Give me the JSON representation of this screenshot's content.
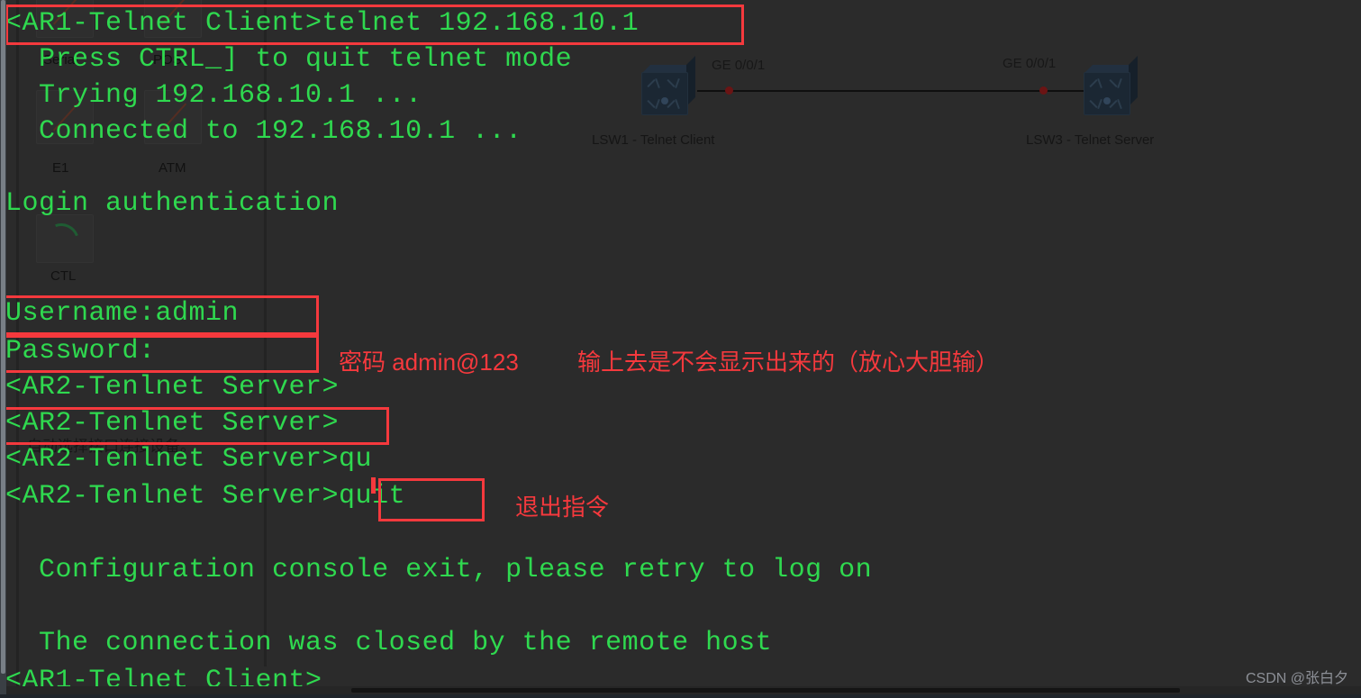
{
  "window": {
    "kind": "eNSP CLI terminal over network topology",
    "background_color": "#2b2b2b",
    "terminal_text_color": "#2fd94f",
    "annotation_color": "#f5393d"
  },
  "terminal": {
    "lines": [
      "<AR1-Telnet Client>telnet 192.168.10.1",
      "  Press CTRL_] to quit telnet mode",
      "  Trying 192.168.10.1 ...",
      "  Connected to 192.168.10.1 ...",
      "",
      "Login authentication",
      "",
      "",
      "Username:admin",
      "Password:",
      "<AR2-Tenlnet Server>",
      "<AR2-Tenlnet Server>",
      "<AR2-Tenlnet Server>qu",
      "<AR2-Tenlnet Server>quit",
      "",
      "  Configuration console exit, please retry to log on",
      "",
      "  The connection was closed by the remote host",
      "<AR1-Telnet Client>"
    ]
  },
  "annotations": {
    "password_note": "密码 admin@123",
    "hidden_input_note": "输上去是不会显示出来的（放心大胆输）",
    "quit_note": "退出指令"
  },
  "topology": {
    "left_device": {
      "name": "LSW1 - Telnet Client",
      "interface": "GE 0/0/1",
      "icon": "switch-icon"
    },
    "right_device": {
      "name": "LSW3 - Telnet Server",
      "interface": "GE 0/0/1",
      "icon": "switch-icon"
    }
  },
  "background_palette": {
    "labels": [
      "Serial",
      "POS",
      "E1",
      "ATM",
      "CTL"
    ],
    "note": "自动选择接口连接设备。"
  },
  "watermark": {
    "text": "CSDN @张白夕"
  }
}
